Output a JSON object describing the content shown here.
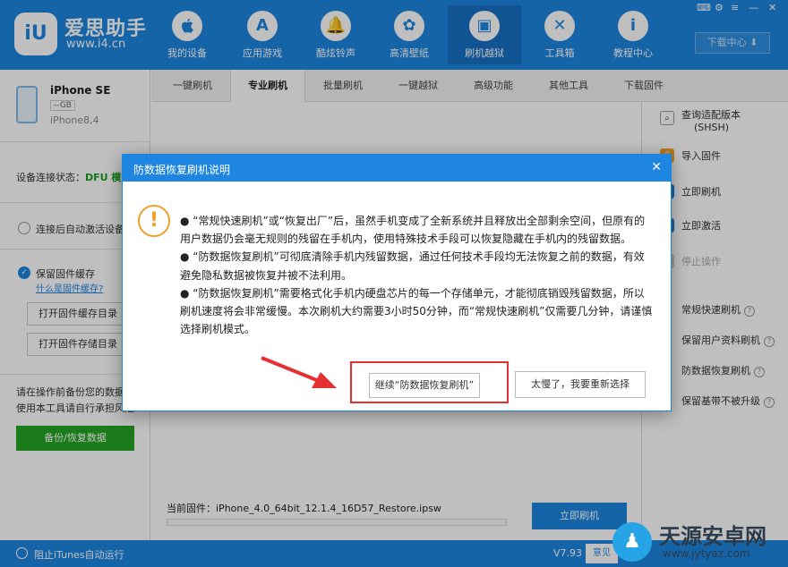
{
  "header": {
    "logo_icon": "iU",
    "app_name": "爱思助手",
    "app_url": "www.i4.cn",
    "nav": [
      {
        "label": "我的设备",
        "icon": ""
      },
      {
        "label": "应用游戏",
        "icon": "A"
      },
      {
        "label": "酷炫铃声",
        "icon": "🔔"
      },
      {
        "label": "高清壁纸",
        "icon": "✿"
      },
      {
        "label": "刷机越狱",
        "icon": "▣"
      },
      {
        "label": "工具箱",
        "icon": "✕"
      },
      {
        "label": "教程中心",
        "icon": "i"
      }
    ],
    "active_nav": "刷机越狱",
    "window_controls": [
      "⌨",
      "⚙",
      "≡",
      "—",
      "✕"
    ],
    "download_center": "下载中心 ⬇"
  },
  "device": {
    "name": "iPhone SE",
    "capacity": "--GB",
    "model": "iPhone8,4",
    "connection_label": "设备连接状态：",
    "connection_value": "DFU 模式"
  },
  "left_panel": {
    "auto_activate": "连接后自动激活设备",
    "keep_firmware": "保留固件缓存",
    "what_is_cache": "什么是固件缓存?",
    "open_cache_dir": "打开固件缓存目录",
    "open_store_dir": "打开固件存储目录",
    "note_line1": "请在操作前备份您的数据",
    "note_line2": "使用本工具请自行承担风险",
    "backup_button": "备份/恢复数据"
  },
  "tabs": [
    "一键刷机",
    "专业刷机",
    "批量刷机",
    "一键越狱",
    "高级功能",
    "其他工具",
    "下载固件"
  ],
  "active_tab": "专业刷机",
  "right_panel": {
    "query_line1": "查询适配版本",
    "query_line2": "(SHSH)",
    "query_icon_text": "SHSH",
    "import_firmware": "导入固件",
    "flash_now": "立即刷机",
    "activate_now": "立即激活",
    "stop": "停止操作",
    "modes": [
      "常规快速刷机",
      "保留用户资料刷机",
      "防数据恢复刷机",
      "保留基带不被升级"
    ]
  },
  "bottom": {
    "firmware_label": "当前固件：",
    "firmware_file": "iPhone_4.0_64bit_12.1.4_16D57_Restore.ipsw",
    "flash_button": "立即刷机"
  },
  "statusbar": {
    "block_itunes": "阻止iTunes自动运行",
    "version": "V7.93",
    "feedback": "意见"
  },
  "watermark": {
    "name": "天源安卓网",
    "url": "www.jytyaz.com"
  },
  "dialog": {
    "title": "防数据恢复刷机说明",
    "close": "✕",
    "warn_icon": "!",
    "p1": "●  “常规快速刷机”或“恢复出厂”后，虽然手机变成了全新系统并且释放出全部剩余空间，但原有的用户数据仍会毫无规则的残留在手机内，使用特殊技术手段可以恢复隐藏在手机内的残留数据。",
    "p2": "●  “防数据恢复刷机”可彻底清除手机内残留数据，通过任何技术手段均无法恢复之前的数据，有效避免隐私数据被恢复并被不法利用。",
    "p3": "●  “防数据恢复刷机”需要格式化手机内硬盘芯片的每一个存储单元，才能彻底销毁残留数据，所以刷机速度将会非常缓慢。本次刷机大约需要3小时50分钟，而“常规快速刷机”仅需要几分钟，请谨慎选择刷机模式。",
    "continue_button": "继续“防数据恢复刷机”",
    "reselect_button": "太慢了，我要重新选择"
  },
  "colors": {
    "brand": "#1e86e0",
    "green": "#24a524",
    "warning": "#f0a02a",
    "highlight": "#e33030"
  }
}
